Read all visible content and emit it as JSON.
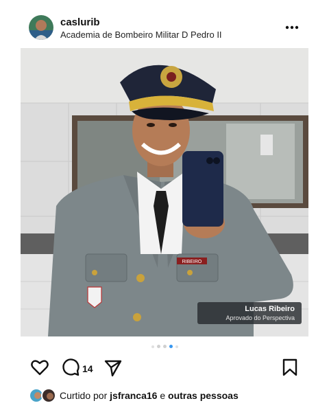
{
  "post": {
    "username": "caslurib",
    "location": "Academia de Bombeiro Militar D Pedro II",
    "more_icon": "more-horizontal-icon"
  },
  "photo": {
    "overlay_name": "Lucas Ribeiro",
    "overlay_subtitle": "Aprovado do Perspectiva",
    "nametag": "RIBEIRO"
  },
  "carousel": {
    "total": 5,
    "current": 4
  },
  "actions": {
    "like_icon": "heart-icon",
    "comment_icon": "comment-icon",
    "comment_count": "14",
    "share_icon": "send-icon",
    "save_icon": "bookmark-icon"
  },
  "likes": {
    "prefix": "Curtido por",
    "user": "jsfranca16",
    "conj": "e",
    "others": "outras pessoas"
  },
  "colors": {
    "accent": "#3897f0",
    "text": "#111111"
  }
}
